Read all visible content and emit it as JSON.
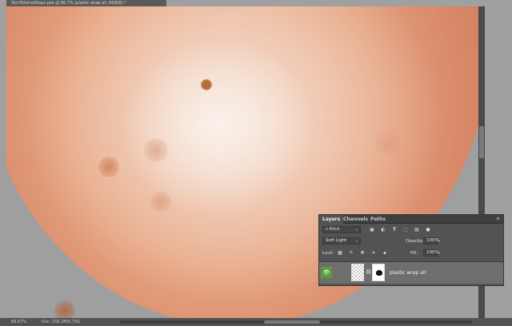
{
  "document": {
    "tab_title": "SkinTutorialSteps.psb @ 66.7% (plastic wrap all, RGB/8) *"
  },
  "status_bar": {
    "zoom": "66.67%",
    "doc_info": "Doc: 156.2M/0.75G"
  },
  "layers_panel": {
    "tabs": [
      "Layers",
      "Channels",
      "Paths"
    ],
    "active_tab": "Layers",
    "filter": {
      "kind": "Kind"
    },
    "blend_mode": "Soft Light",
    "opacity_label": "Opacity:",
    "opacity_value": "100%",
    "lock_label": "Lock:",
    "fill_label": "Fill:",
    "fill_value": "100%",
    "layers": [
      {
        "name": "plastic wrap all",
        "visible": true,
        "has_mask": true
      }
    ]
  },
  "colors": {
    "visibility_green": "#5c9c3c",
    "panel_bg": "#535353",
    "canvas_bg": "#a0a0a0"
  },
  "icons": {
    "filter_icons": [
      "image-filter-icon",
      "adjustment-filter-icon",
      "type-filter-icon",
      "shape-filter-icon",
      "smart-object-filter-icon",
      "filter-toggle-icon"
    ],
    "lock_icons": [
      "lock-transparent-pixels-icon",
      "lock-image-pixels-icon",
      "lock-position-icon",
      "lock-artboard-icon",
      "lock-all-icon"
    ]
  }
}
